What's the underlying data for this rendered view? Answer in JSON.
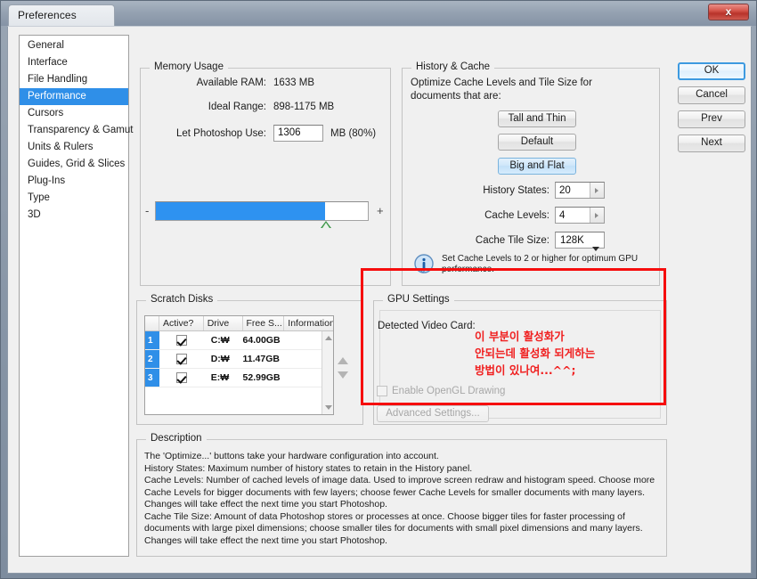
{
  "window": {
    "title": "Preferences",
    "close_label": "x"
  },
  "sidebar": {
    "items": [
      {
        "label": "General",
        "selected": false
      },
      {
        "label": "Interface",
        "selected": false
      },
      {
        "label": "File Handling",
        "selected": false
      },
      {
        "label": "Performance",
        "selected": true
      },
      {
        "label": "Cursors",
        "selected": false
      },
      {
        "label": "Transparency & Gamut",
        "selected": false
      },
      {
        "label": "Units & Rulers",
        "selected": false
      },
      {
        "label": "Guides, Grid & Slices",
        "selected": false
      },
      {
        "label": "Plug-Ins",
        "selected": false
      },
      {
        "label": "Type",
        "selected": false
      },
      {
        "label": "3D",
        "selected": false
      }
    ]
  },
  "memory_usage": {
    "legend": "Memory Usage",
    "available_ram_label": "Available RAM:",
    "available_ram_value": "1633 MB",
    "ideal_range_label": "Ideal Range:",
    "ideal_range_value": "898-1175 MB",
    "let_photoshop_use_label": "Let Photoshop Use:",
    "let_photoshop_use_value": "1306",
    "unit_percent": "MB (80%)",
    "slider_minus": "-",
    "slider_plus": "+",
    "slider_percent": 80
  },
  "history_cache": {
    "legend": "History & Cache",
    "optimize_text": "Optimize Cache Levels and Tile Size for\ndocuments that are:",
    "buttons": [
      {
        "label": "Tall and Thin",
        "active": false
      },
      {
        "label": "Default",
        "active": false
      },
      {
        "label": "Big and Flat",
        "active": true
      }
    ],
    "history_states_label": "History States:",
    "history_states_value": "20",
    "cache_levels_label": "Cache Levels:",
    "cache_levels_value": "4",
    "cache_tile_size_label": "Cache Tile Size:",
    "cache_tile_size_value": "128K",
    "info_text": "Set Cache Levels to 2 or higher for optimum GPU\nperformance."
  },
  "scratch_disks": {
    "legend": "Scratch Disks",
    "columns": [
      "",
      "Active?",
      "Drive",
      "Free S...",
      "Information"
    ],
    "rows": [
      {
        "index": "1",
        "active": true,
        "drive": "C:₩",
        "free": "64.00GB",
        "info": ""
      },
      {
        "index": "2",
        "active": true,
        "drive": "D:₩",
        "free": "11.47GB",
        "info": ""
      },
      {
        "index": "3",
        "active": true,
        "drive": "E:₩",
        "free": "52.99GB",
        "info": ""
      }
    ]
  },
  "gpu_settings": {
    "legend": "GPU Settings",
    "detected_video_card_label": "Detected Video Card:",
    "detected_video_card_value": "",
    "enable_opengl_label": "Enable OpenGL Drawing",
    "enable_opengl_checked": false,
    "advanced_settings_label": "Advanced Settings...",
    "annotation_text": "이 부분이 활성화가\n안되는데 활성화 되게하는\n방법이 있나여...^^;",
    "annotation_color": "#f02020"
  },
  "description": {
    "legend": "Description",
    "text": "The 'Optimize...' buttons take your hardware configuration into account.\nHistory States: Maximum number of history states to retain in the History panel.\nCache Levels: Number of cached levels of image data.  Used to improve screen redraw and histogram speed.  Choose more Cache Levels for bigger documents with few layers; choose fewer Cache Levels for smaller documents with many layers. Changes will take effect the next time you start Photoshop.\nCache Tile Size: Amount of data Photoshop stores or processes at once. Choose bigger tiles for faster processing of documents with large pixel dimensions; choose smaller tiles for documents with small pixel dimensions and many layers. Changes will take effect the next time you start Photoshop."
  },
  "action_buttons": [
    {
      "label": "OK",
      "default": true
    },
    {
      "label": "Cancel",
      "default": false
    },
    {
      "label": "Prev",
      "default": false
    },
    {
      "label": "Next",
      "default": false
    }
  ],
  "colors": {
    "accent_blue": "#2f8fe8",
    "slider_blue": "#2e92f0",
    "annotation_red": "#f60d0d",
    "dialog_bg": "#f0f0f0"
  }
}
